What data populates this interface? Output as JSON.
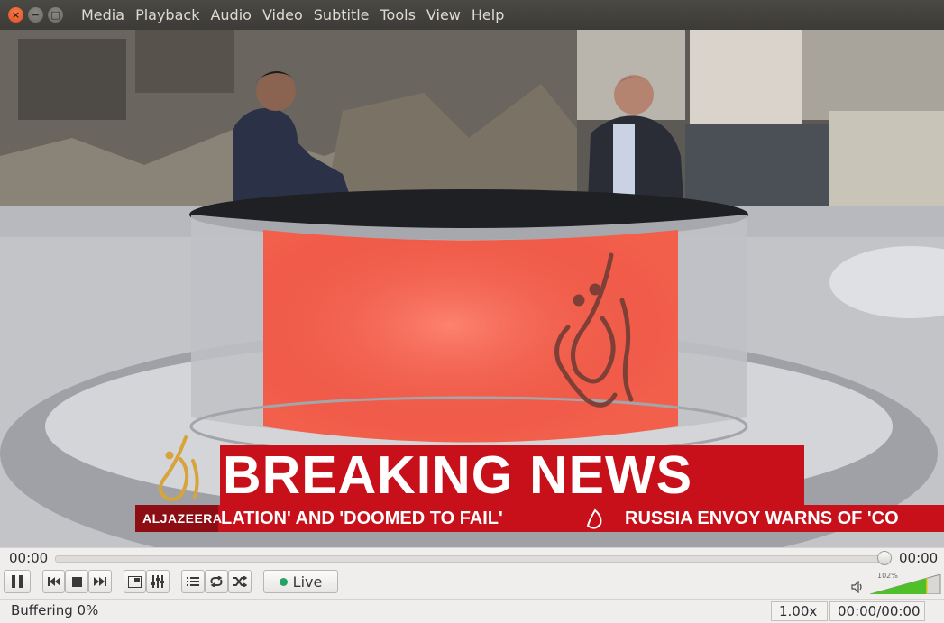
{
  "window": {
    "close_glyph": "×",
    "min_glyph": "−",
    "max_glyph": "□"
  },
  "menu": [
    "Media",
    "Playback",
    "Audio",
    "Video",
    "Subtitle",
    "Tools",
    "View",
    "Help"
  ],
  "video": {
    "headline": "BREAKING NEWS",
    "ticker_left": "LATION' AND 'DOOMED TO FAIL'",
    "ticker_right": "RUSSIA ENVOY WARNS OF 'CO",
    "brand": "ALJAZEERA"
  },
  "controls": {
    "elapsed": "00:00",
    "remaining": "00:00",
    "live_label": "Live",
    "volume_percent": "102%",
    "volume_level": 1.02,
    "buttons": [
      "pause-icon",
      "previous-icon",
      "stop-icon",
      "next-icon",
      "fullscreen-icon",
      "equalizer-icon",
      "playlist-icon",
      "loop-icon",
      "shuffle-icon",
      "speaker-icon"
    ]
  },
  "status": {
    "message": "Buffering 0%",
    "speed": "1.00x",
    "time": "00:00/00:00"
  },
  "colors": {
    "accent_green": "#26a269",
    "breaking_red": "#c8101a",
    "close_orange": "#e0501c"
  }
}
